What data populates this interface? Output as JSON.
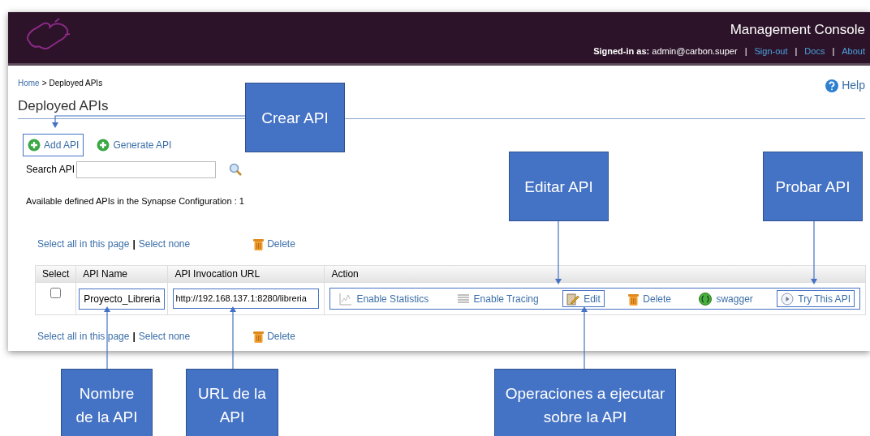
{
  "header": {
    "title": "Management Console",
    "signed_in_label": "Signed-in as:",
    "user": "admin@carbon.super",
    "separator": "|",
    "links": [
      "Sign-out",
      "Docs",
      "About"
    ]
  },
  "breadcrumb": {
    "items": [
      "Home",
      "Deployed APIs"
    ],
    "separator": ">"
  },
  "help": "Help",
  "page_title": "Deployed APIs",
  "actions": [
    {
      "label": "Add API",
      "highlighted": true
    },
    {
      "label": "Generate API",
      "highlighted": false
    }
  ],
  "search": {
    "label": "Search API"
  },
  "summary": "Available defined APIs in the Synapse Configuration : 1",
  "selection_top": {
    "links": [
      "Select all in this page",
      "Select none"
    ],
    "separator": "|",
    "delete": "Delete"
  },
  "table": {
    "columns": [
      "Select",
      "API Name",
      "API Invocation URL",
      "Action"
    ],
    "rows": [
      {
        "checked": false,
        "name": "Proyecto_Libreria",
        "url": "http://192.168.137.1:8280/libreria",
        "highlighted": true,
        "actions": [
          {
            "kind": "statistics",
            "label": "Enable Statistics",
            "highlighted": false
          },
          {
            "kind": "tracing",
            "label": "Enable Tracing",
            "highlighted": false
          },
          {
            "kind": "edit",
            "label": "Edit",
            "highlighted": true
          },
          {
            "kind": "delete",
            "label": "Delete",
            "highlighted": false
          },
          {
            "kind": "swagger",
            "label": "swagger",
            "highlighted": false
          },
          {
            "kind": "try",
            "label": "Try This API",
            "highlighted": true
          }
        ]
      }
    ]
  },
  "selection_bottom": {
    "links": [
      "Select all in this page",
      "Select none"
    ],
    "separator": "|",
    "delete": "Delete"
  },
  "callouts": [
    {
      "text": "Crear API"
    },
    {
      "text": "Editar API"
    },
    {
      "text": "Probar API"
    },
    {
      "text": "Nombre de la API"
    },
    {
      "text": "URL de la API"
    },
    {
      "text": "Operaciones a ejecutar sobre la API"
    }
  ]
}
